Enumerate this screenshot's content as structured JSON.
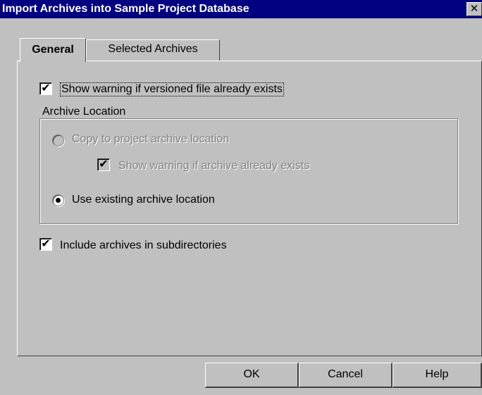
{
  "window": {
    "title": "Import Archives into Sample Project Database",
    "close_glyph": "✕"
  },
  "tabs": [
    {
      "label": "General",
      "active": true
    },
    {
      "label": "Selected Archives",
      "active": false
    }
  ],
  "options": {
    "show_warning_versioned": {
      "label": "Show warning if versioned file already exists",
      "checked": true
    },
    "include_subdirectories": {
      "label": "Include archives in subdirectories",
      "checked": true
    }
  },
  "archive_location": {
    "legend": "Archive Location",
    "copy_to_project": {
      "label": "Copy to project archive location",
      "selected": false,
      "enabled": false
    },
    "show_warning_archive": {
      "label": "Show warning if archive already exists",
      "checked": true,
      "enabled": false
    },
    "use_existing": {
      "label": "Use existing archive location",
      "selected": true,
      "enabled": true
    }
  },
  "buttons": {
    "ok": "OK",
    "cancel": "Cancel",
    "help": "Help"
  },
  "check_glyph": "✔"
}
